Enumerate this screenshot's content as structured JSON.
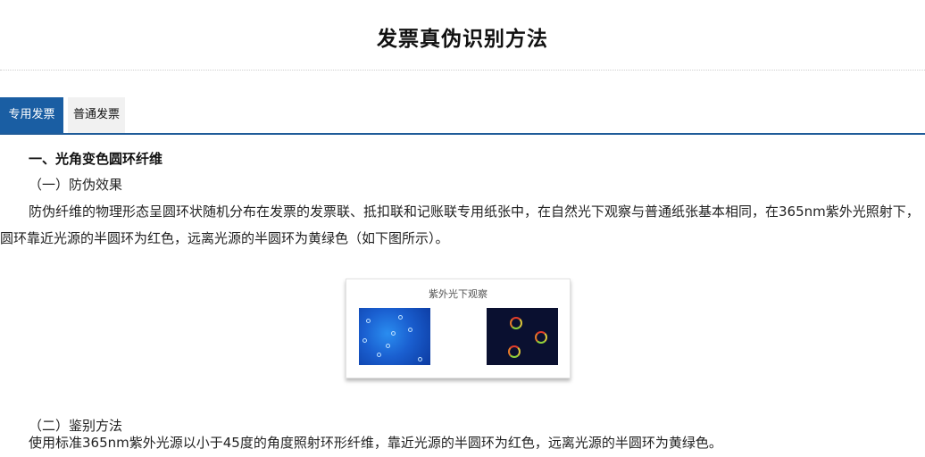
{
  "header": {
    "title": "发票真伪识别方法"
  },
  "tabs": [
    {
      "label": "专用发票",
      "active": true
    },
    {
      "label": "普通发票",
      "active": false
    }
  ],
  "section1": {
    "heading": "一、光角变色圆环纤维",
    "sub_heading": "（一）防伪效果",
    "paragraph": "防伪纤维的物理形态呈圆环状随机分布在发票的发票联、抵扣联和记账联专用纸张中，在自然光下观察与普通纸张基本相同，在365nm紫外光照射下，圆环靠近光源的半圆环为红色，远离光源的半圆环为黄绿色（如下图所示）。",
    "figure_caption": "紫外光下观察"
  },
  "section2": {
    "sub_heading": "（二）鉴别方法",
    "paragraph": "使用标准365nm紫外光源以小于45度的角度照射环形纤维，靠近光源的半圆环为红色，远离光源的半圆环为黄绿色。"
  },
  "colors": {
    "tab_active_bg": "#1a5ea3",
    "tab_border": "#1f5c99"
  }
}
